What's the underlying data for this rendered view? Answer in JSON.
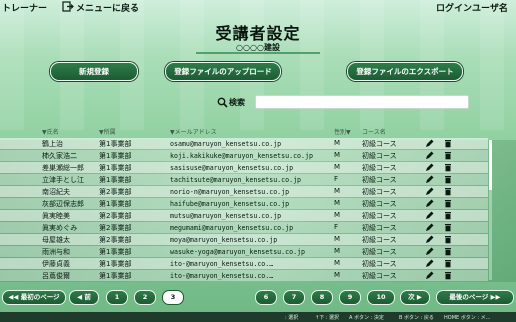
{
  "topbar": {
    "left_title": "トレーナー",
    "back_label": "メニューに戻る",
    "user_name": "ログインユーザ名"
  },
  "header": {
    "title": "受講者設定",
    "company": "○○○○建設"
  },
  "actions": {
    "new_label": "新規登録",
    "upload_label": "登録ファイルのアップロード",
    "export_label": "登録ファイルのエクスポート"
  },
  "search": {
    "label": "検索",
    "value": "",
    "placeholder": ""
  },
  "table": {
    "columns": [
      "氏名",
      "所属",
      "メールアドレス",
      "性別",
      "コース名"
    ],
    "rows": [
      {
        "name": "鶴上治",
        "dept": "第1事業部",
        "email": "osamu@maruyon_kensetsu.co.jp",
        "sex": "M",
        "course": "初級コース"
      },
      {
        "name": "柿久家浩二",
        "dept": "第1事業部",
        "email": "koji.kakikuke@maruyon_kensetsu.co.jp",
        "sex": "M",
        "course": "初級コース"
      },
      {
        "name": "差巣瀬総一郎",
        "dept": "第1事業部",
        "email": "sasisuse@maruyon_kensetsu.co.jp",
        "sex": "M",
        "course": "初級コース"
      },
      {
        "name": "立津手とし江",
        "dept": "第1事業部",
        "email": "tachitsute@maruyon_kensetsu.co.jp",
        "sex": "F",
        "course": "初級コース"
      },
      {
        "name": "南沼紀夫",
        "dept": "第2事業部",
        "email": "norio-n@maruyon_kensetsu.co.jp",
        "sex": "M",
        "course": "初級コース"
      },
      {
        "name": "灰部辺保志郎",
        "dept": "第1事業部",
        "email": "haifube@maruyon_kensetsu.co.jp",
        "sex": "M",
        "course": "初級コース"
      },
      {
        "name": "眞実睦美",
        "dept": "第2事業部",
        "email": "mutsu@maruyon_kensetsu.co.jp",
        "sex": "M",
        "course": "初級コース"
      },
      {
        "name": "眞実めぐみ",
        "dept": "第2事業部",
        "email": "megumami@maruyon_kensetsu.co.jp",
        "sex": "F",
        "course": "初級コース"
      },
      {
        "name": "母屋雄太",
        "dept": "第2事業部",
        "email": "moya@maruyon_kensetsu.co.jp",
        "sex": "M",
        "course": "初級コース"
      },
      {
        "name": "雨洲与和",
        "dept": "第1事業部",
        "email": "wasuke-yoga@maruyon_kensetsu.co.jp",
        "sex": "M",
        "course": "初級コース"
      },
      {
        "name": "伊藤貞義",
        "dept": "第1事業部",
        "email": "ito-@maruyon_kensetsu.co.…",
        "sex": "M",
        "course": "初級コース"
      },
      {
        "name": "呂蔦俊爾",
        "dept": "第1事業部",
        "email": "ito-@maruyon_kensetsu.co.…",
        "sex": "M",
        "course": "初級コース"
      }
    ]
  },
  "pagination": {
    "first_label": "最初のページ",
    "prev_label": "前",
    "pages": [
      "1",
      "2",
      "3",
      "6",
      "7",
      "8",
      "9",
      "10"
    ],
    "current": "3",
    "next_label": "次",
    "last_label": "最後のページ"
  },
  "footer": {
    "items": [
      ": 選択",
      "↑下 : 選択",
      "A ボタン : 決定",
      "B ボタン : 戻る",
      "HOME ボタン : メ..."
    ]
  }
}
